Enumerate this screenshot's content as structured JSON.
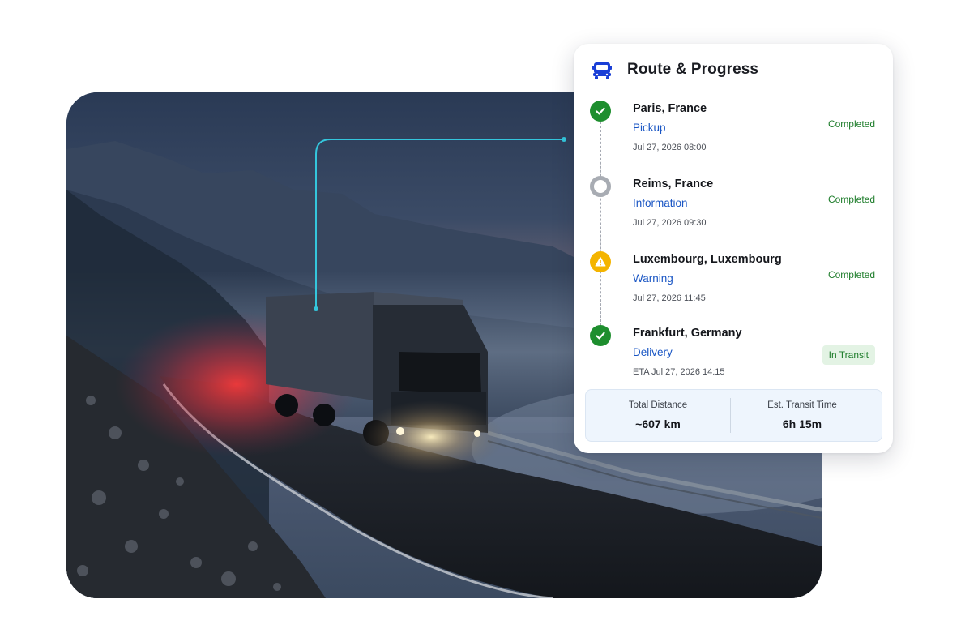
{
  "card": {
    "title": "Route & Progress",
    "icon": "truck-icon"
  },
  "stops": [
    {
      "name": "Paris, France",
      "type": "Pickup",
      "time": "Jul 27, 2026 08:00",
      "status": "Completed",
      "icon": "check-circle-icon"
    },
    {
      "name": "Reims, France",
      "type": "Information",
      "time": "Jul 27, 2026 09:30",
      "status": "Completed",
      "icon": "info-dot-icon"
    },
    {
      "name": "Luxembourg, Luxembourg",
      "type": "Warning",
      "time": "Jul 27, 2026 11:45",
      "status": "Completed",
      "icon": "warning-icon"
    },
    {
      "name": "Frankfurt, Germany",
      "type": "Delivery",
      "time": "ETA Jul 27, 2026 14:15",
      "status": "In Transit",
      "icon": "check-circle-icon"
    }
  ],
  "summary": {
    "distance_label": "Total Distance",
    "distance_value": "~607 km",
    "transit_label": "Est. Transit Time",
    "transit_value": "6h 15m"
  },
  "colors": {
    "accent_blue": "#1a56c4",
    "success_green": "#1e8e2e",
    "warning_yellow": "#f4b400",
    "connector_cyan": "#34c6dc"
  }
}
